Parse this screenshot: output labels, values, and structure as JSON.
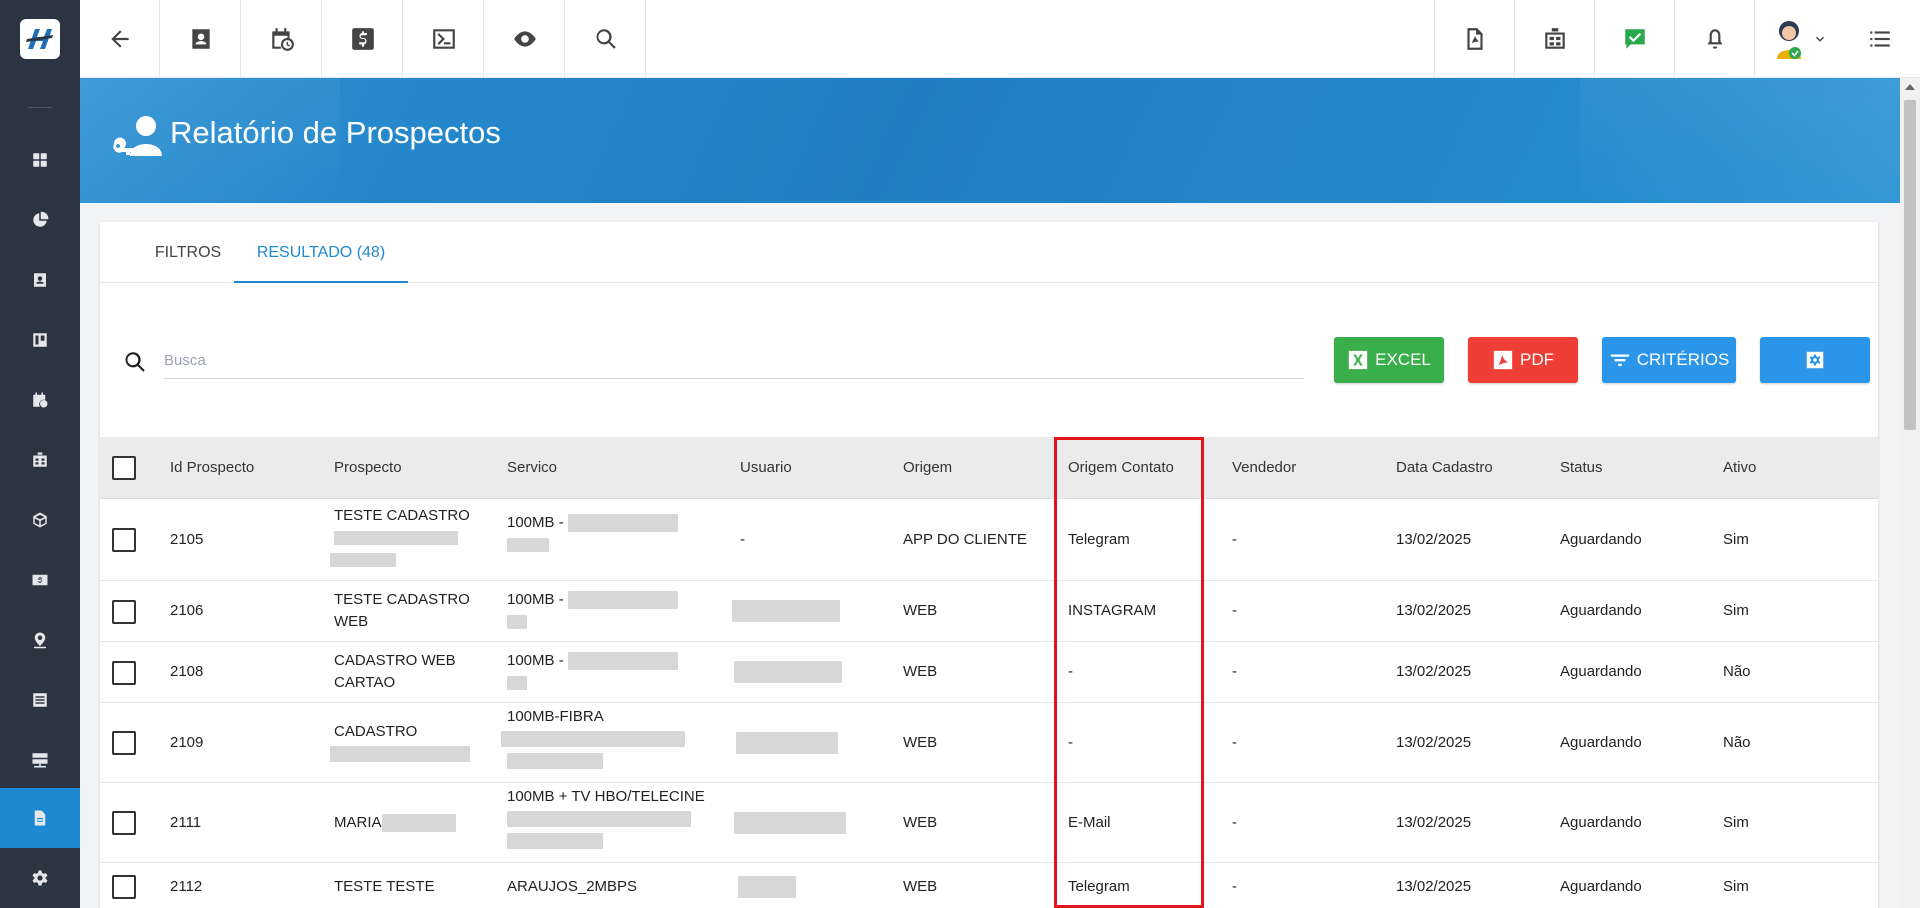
{
  "sidebar": {
    "items": [
      {
        "name": "dashboard-icon"
      },
      {
        "name": "pie-chart-icon"
      },
      {
        "name": "contact-card-icon"
      },
      {
        "name": "kanban-icon"
      },
      {
        "name": "calendar-clock-icon"
      },
      {
        "name": "building-icon"
      },
      {
        "name": "box-icon"
      },
      {
        "name": "money-icon"
      },
      {
        "name": "map-pin-icon"
      },
      {
        "name": "list-icon"
      },
      {
        "name": "server-icon"
      },
      {
        "name": "document-icon"
      },
      {
        "name": "gear-icon"
      }
    ],
    "active_index": 11
  },
  "topbar": {
    "left_icons": [
      "back-arrow-icon",
      "contact-card-icon",
      "calendar-clock-icon",
      "dollar-icon",
      "terminal-icon",
      "eye-icon",
      "search-icon"
    ],
    "right_icons": [
      "pdf-file-icon",
      "building-icon",
      "chat-check-icon",
      "bell-icon",
      "avatar",
      "menu-icon"
    ]
  },
  "header": {
    "title": "Relatório de Prospectos"
  },
  "tabs": [
    {
      "label": "FILTROS",
      "active": false
    },
    {
      "label": "RESULTADO (48)",
      "active": true
    }
  ],
  "search": {
    "placeholder": "Busca",
    "value": ""
  },
  "actions": {
    "excel_label": "EXCEL",
    "pdf_label": "PDF",
    "criteria_label": "CRITÉRIOS"
  },
  "colors": {
    "accent": "#1e88d2",
    "excel": "#3aae4a",
    "pdf": "#ef3e36",
    "criteria": "#2b95e9",
    "highlight": "#e4141b"
  },
  "table": {
    "columns": [
      "Id Prospecto",
      "Prospecto",
      "Servico",
      "Usuario",
      "Origem",
      "Origem Contato",
      "Vendedor",
      "Data Cadastro",
      "Status",
      "Ativo"
    ],
    "rows": [
      {
        "id": "2105",
        "prospecto": [
          "TESTE CADASTRO"
        ],
        "servico": [
          "100MB -"
        ],
        "usuario": "-",
        "origem": "APP DO CLIENTE",
        "origem_contato": "Telegram",
        "vendedor": "-",
        "data": "13/02/2025",
        "status": "Aguardando",
        "ativo": "Sim"
      },
      {
        "id": "2106",
        "prospecto": [
          "TESTE CADASTRO",
          "WEB"
        ],
        "servico": [
          "100MB -"
        ],
        "usuario": "",
        "origem": "WEB",
        "origem_contato": "INSTAGRAM",
        "vendedor": "-",
        "data": "13/02/2025",
        "status": "Aguardando",
        "ativo": "Sim"
      },
      {
        "id": "2108",
        "prospecto": [
          "CADASTRO WEB",
          "CARTAO"
        ],
        "servico": [
          "100MB -"
        ],
        "usuario": "",
        "origem": "WEB",
        "origem_contato": "-",
        "vendedor": "-",
        "data": "13/02/2025",
        "status": "Aguardando",
        "ativo": "Não"
      },
      {
        "id": "2109",
        "prospecto": [
          "CADASTRO"
        ],
        "servico": [
          "100MB-FIBRA"
        ],
        "usuario": "",
        "origem": "WEB",
        "origem_contato": "-",
        "vendedor": "-",
        "data": "13/02/2025",
        "status": "Aguardando",
        "ativo": "Não"
      },
      {
        "id": "2111",
        "prospecto": [
          "MARIA"
        ],
        "servico": [
          "100MB + TV HBO/TELECINE"
        ],
        "usuario": "",
        "origem": "WEB",
        "origem_contato": "E-Mail",
        "vendedor": "-",
        "data": "13/02/2025",
        "status": "Aguardando",
        "ativo": "Sim"
      },
      {
        "id": "2112",
        "prospecto": [
          "TESTE TESTE"
        ],
        "servico": [
          "ARAUJOS_2MBPS"
        ],
        "usuario": "",
        "origem": "WEB",
        "origem_contato": "Telegram",
        "vendedor": "-",
        "data": "13/02/2025",
        "status": "Aguardando",
        "ativo": "Sim"
      }
    ]
  }
}
